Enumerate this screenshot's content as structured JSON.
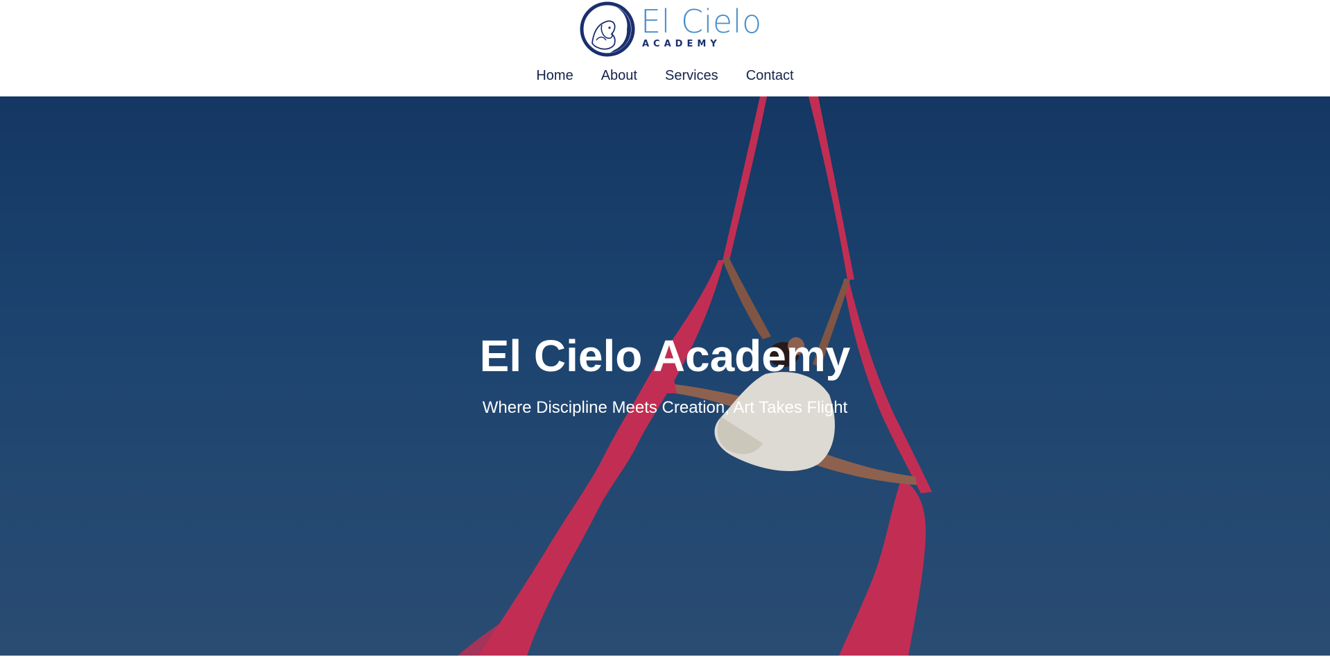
{
  "brand": {
    "name": "El Cielo",
    "subtitle": "ACADEMY",
    "colors": {
      "primary": "#1b2f6e",
      "accent": "#4a8fc9"
    },
    "logo_icon": "dancer-profile-logo-icon"
  },
  "nav": {
    "items": [
      {
        "label": "Home"
      },
      {
        "label": "About"
      },
      {
        "label": "Services"
      },
      {
        "label": "Contact"
      }
    ]
  },
  "hero": {
    "title": "El Cielo Academy",
    "subtitle": "Where Discipline Meets Creation, Art Takes Flight",
    "image": "aerial-silks-dancer",
    "colors": {
      "sky": "#1f4774",
      "silk": "#d42e52"
    }
  }
}
